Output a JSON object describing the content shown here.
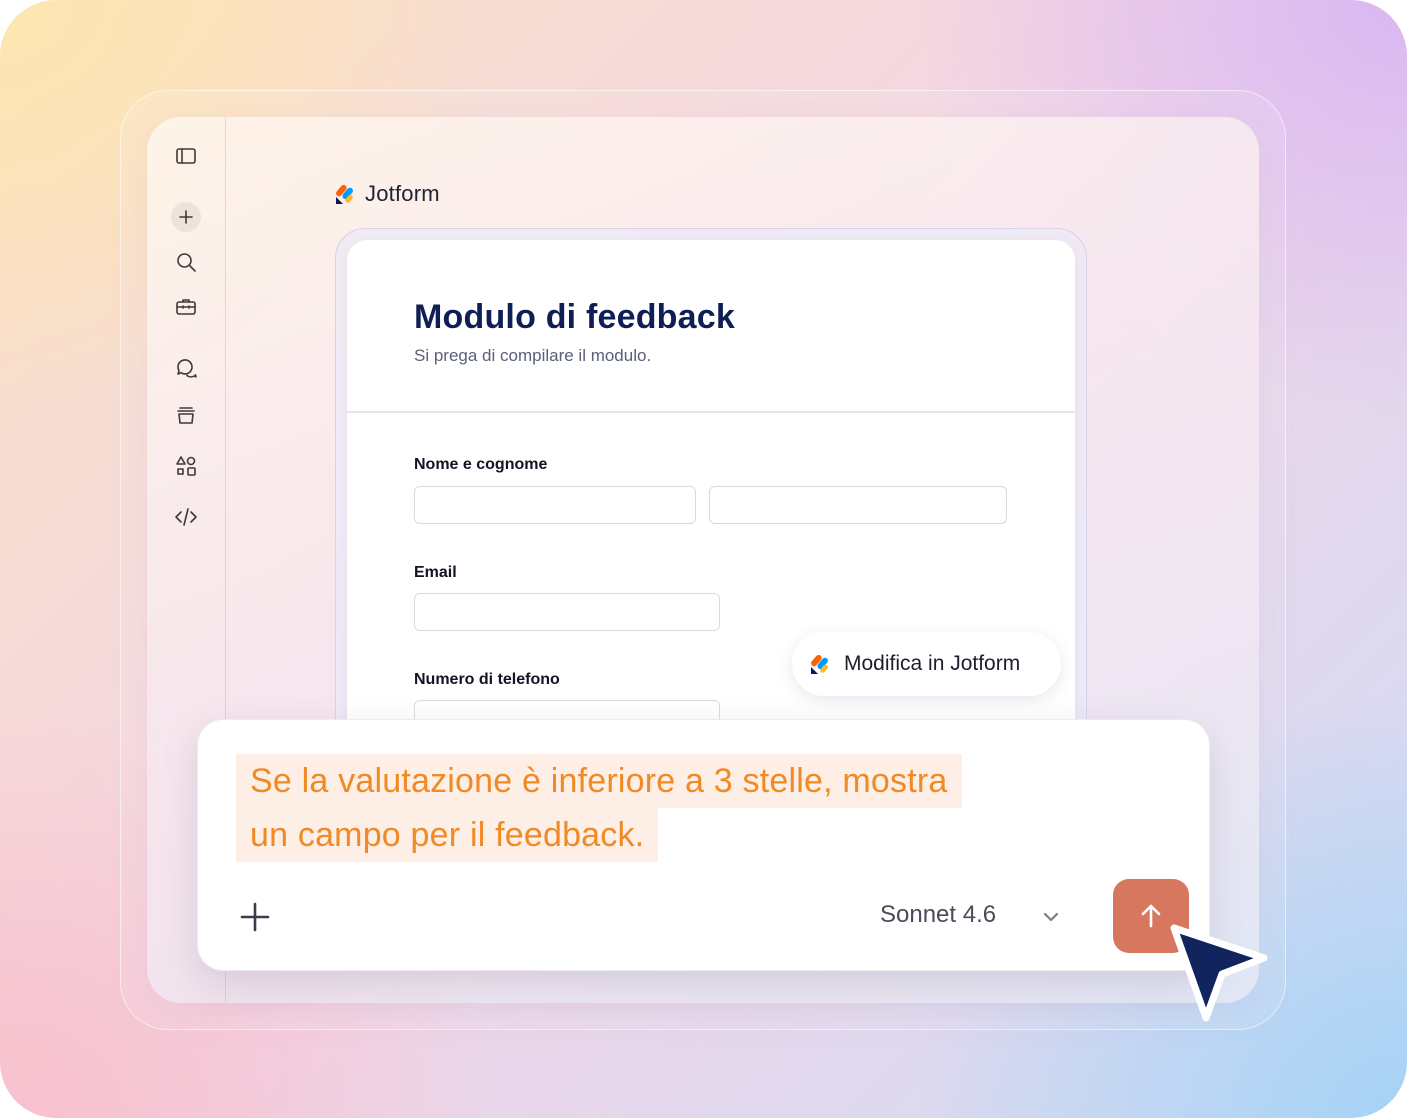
{
  "brand": {
    "name": "Jotform"
  },
  "sidebar": {
    "items": [
      {
        "icon": "sidebar-toggle-icon"
      },
      {
        "icon": "plus-icon"
      },
      {
        "icon": "search-icon"
      },
      {
        "icon": "toolbox-icon"
      },
      {
        "icon": "chat-icon"
      },
      {
        "icon": "archive-icon"
      },
      {
        "icon": "shapes-icon"
      },
      {
        "icon": "code-icon"
      }
    ]
  },
  "form": {
    "title": "Modulo di feedback",
    "subtitle": "Si prega di compilare il modulo.",
    "fields": {
      "name_label": "Nome e cognome",
      "email_label": "Email",
      "phone_label": "Numero di telefono"
    }
  },
  "edit_button": {
    "label": "Modifica in Jotform"
  },
  "composer": {
    "prompt_line1": "Se la valutazione è inferiore a 3 stelle, mostra",
    "prompt_line2": "un campo per il feedback.",
    "model": "Sonnet 4.6"
  },
  "colors": {
    "accent_orange": "#f08a24",
    "send_button": "#d8775f",
    "form_title": "#0f1e54",
    "cursor": "#12245e"
  }
}
